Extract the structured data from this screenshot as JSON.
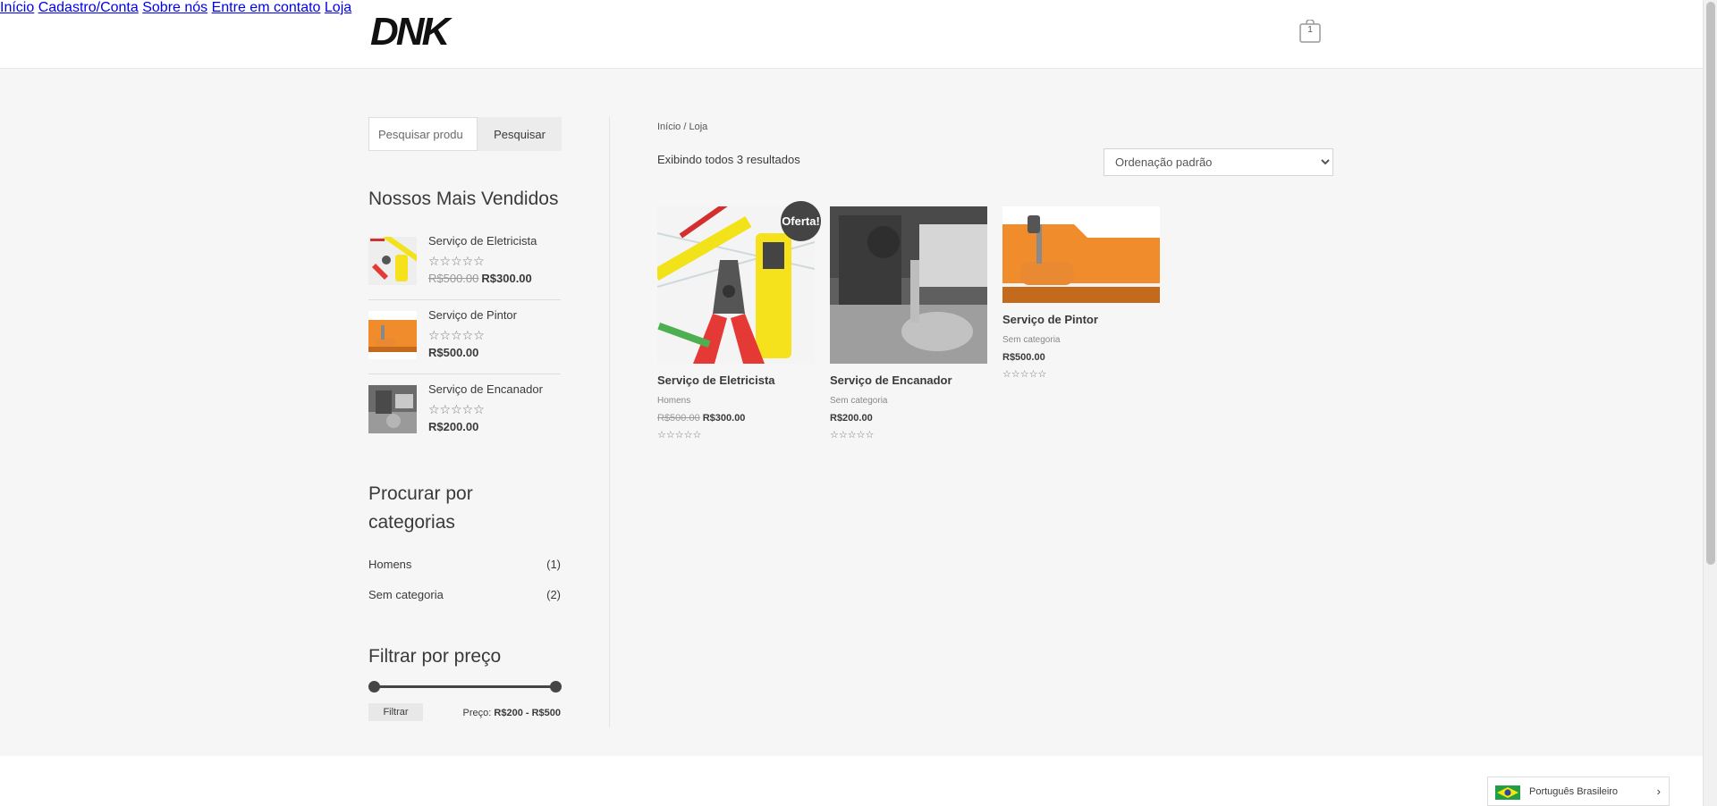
{
  "header": {
    "logo_text": "DNK",
    "nav": [
      "Início",
      "Cadastro/Conta",
      "Sobre nós",
      "Entre em contato",
      "Loja"
    ],
    "cart_count": "1"
  },
  "sidebar": {
    "search": {
      "placeholder": "Pesquisar produ",
      "button": "Pesquisar"
    },
    "best_sellers": {
      "title": "Nossos Mais Vendidos",
      "items": [
        {
          "name": "Serviço de Eletricista",
          "old_price": "R$500.00",
          "price": "R$300.00",
          "rating": 0
        },
        {
          "name": "Serviço de Pintor",
          "old_price": "",
          "price": "R$500.00",
          "rating": 0
        },
        {
          "name": "Serviço de Encanador",
          "old_price": "",
          "price": "R$200.00",
          "rating": 0
        }
      ]
    },
    "categories": {
      "title_line1": "Procurar por",
      "title_line2": "categorias",
      "items": [
        {
          "name": "Homens",
          "count": "(1)"
        },
        {
          "name": "Sem categoria",
          "count": "(2)"
        }
      ]
    },
    "price_filter": {
      "title": "Filtrar por preço",
      "button": "Filtrar",
      "label": "Preço:",
      "range": "R$200 - R$500",
      "min": 200,
      "max": 500
    }
  },
  "main": {
    "breadcrumb": "Início / Loja",
    "result_count": "Exibindo todos 3 resultados",
    "orderby": "Ordenação padrão",
    "sale_badge": "Oferta!",
    "products": [
      {
        "title": "Serviço de Eletricista",
        "category": "Homens",
        "old_price": "R$500.00",
        "price": "R$300.00",
        "on_sale": true
      },
      {
        "title": "Serviço de Encanador",
        "category": "Sem categoria",
        "old_price": "",
        "price": "R$200.00",
        "on_sale": false
      },
      {
        "title": "Serviço de Pintor",
        "category": "Sem categoria",
        "old_price": "",
        "price": "R$500.00",
        "on_sale": false
      }
    ]
  },
  "language": {
    "label": "Português Brasileiro"
  },
  "colors": {
    "accent": "#454545",
    "background": "#f6f6f6",
    "orange": "#f08c2c"
  }
}
